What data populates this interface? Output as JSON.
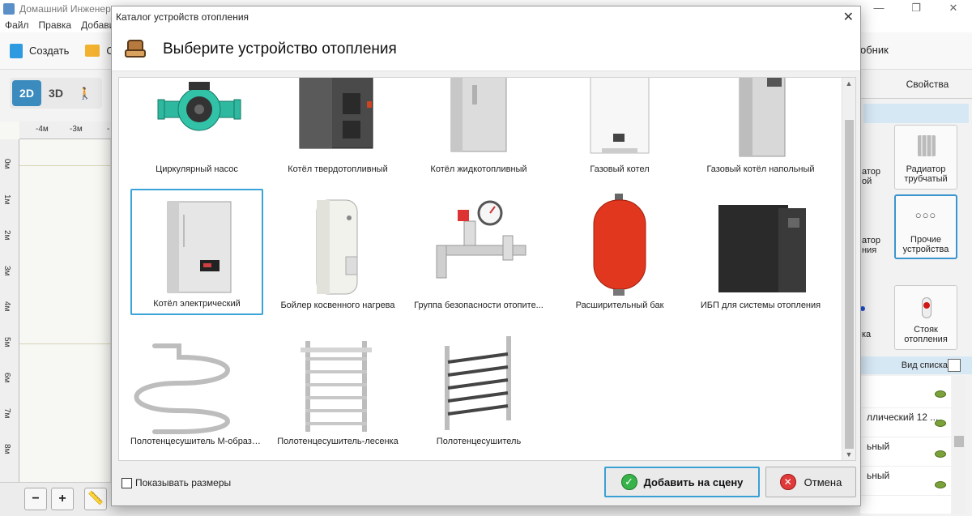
{
  "app": {
    "title": "Домашний Инженер",
    "menu": [
      "Файл",
      "Правка",
      "Добавить"
    ],
    "toolbar": {
      "create": "Создать",
      "open": "Отк",
      "reference": "обник"
    },
    "view_modes": [
      "2D",
      "3D"
    ],
    "ruler_top": [
      "-4м",
      "-3м",
      "-"
    ],
    "ruler_left": [
      "0м",
      "1м",
      "2м",
      "3м",
      "4м",
      "5м",
      "6м",
      "7м",
      "8м"
    ],
    "zoom_out": "−",
    "zoom_in": "+"
  },
  "right_panel": {
    "tab_properties": "Свойства",
    "tiles": [
      {
        "label": "Радиатор трубчатый"
      },
      {
        "label": "Прочие устройства"
      },
      {
        "label": "Стояк отопления"
      }
    ],
    "partial_labels": [
      "атор",
      "ой",
      "атор",
      "ния",
      "ка"
    ],
    "list_view_label": "Вид списка",
    "list_rows": [
      "",
      "ллический 12 ...",
      "ьный",
      "ьный"
    ]
  },
  "dialog": {
    "title": "Каталог устройств отопления",
    "heading": "Выберите устройство отопления",
    "items": [
      {
        "label": "Циркулярный насос"
      },
      {
        "label": "Котёл твердотопливный"
      },
      {
        "label": "Котёл жидкотопливный"
      },
      {
        "label": "Газовый котел"
      },
      {
        "label": "Газовый котёл напольный"
      },
      {
        "label": "Котёл электрический"
      },
      {
        "label": "Бойлер косвенного нагрева"
      },
      {
        "label": "Группа безопасности отопите..."
      },
      {
        "label": "Расширительный бак"
      },
      {
        "label": "ИБП для системы отопления"
      },
      {
        "label": "Полотенцесушитель М-образный"
      },
      {
        "label": "Полотенцесушитель-лесенка"
      },
      {
        "label": "Полотенцесушитель"
      }
    ],
    "show_sizes": "Показывать размеры",
    "add_button": "Добавить на сцену",
    "cancel_button": "Отмена"
  }
}
